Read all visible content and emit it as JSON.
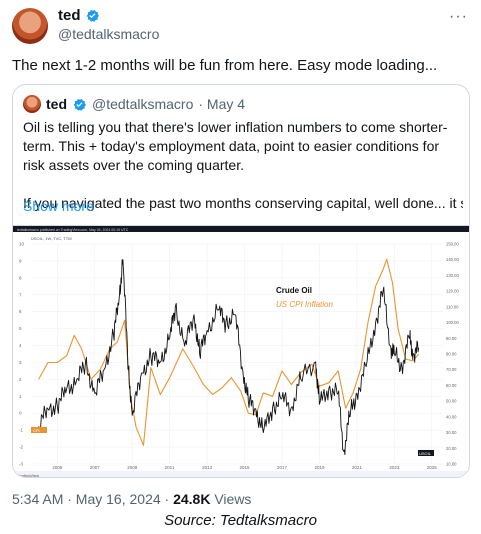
{
  "tweet": {
    "author_name": "ted",
    "author_handle": "@tedtalksmacro",
    "text": "The next 1-2 months will be fun from here. Easy mode loading...",
    "timestamp": "5:34 AM · May 16, 2024 ·",
    "views_count": "24.8K",
    "views_label": "Views",
    "more_label": "···"
  },
  "quote": {
    "author_name": "ted",
    "author_handle": "@tedtalksmacro",
    "date": "· May 4",
    "paragraph1": "Oil is telling you that there's lower inflation numbers to come shorter-term. This + today's employment data, point to easier conditions for risk assets over the coming quarter.",
    "paragraph2": "If you navigated the past two months conserving capital, well done... it shoul...",
    "show_more": "Show more"
  },
  "chart_data": {
    "type": "line",
    "legend": [
      "Crude Oil",
      "US CPI Inflation"
    ],
    "colors": {
      "crude": "#111111",
      "cpi": "#e8952f",
      "legend_cpi": "#e8952f"
    },
    "x_ticks": [
      "2005",
      "2007",
      "2009",
      "2011",
      "2013",
      "2015",
      "2017",
      "2019",
      "2021",
      "2023",
      "2025"
    ],
    "left_axis": {
      "ticks": [
        "10",
        "9",
        "8",
        "7",
        "6",
        "5",
        "4",
        "3",
        "2",
        "1",
        "0",
        "-1",
        "-2",
        "-3"
      ],
      "ylim": [
        -3,
        10
      ]
    },
    "right_axis": {
      "ticks": [
        "150.00",
        "140.00",
        "130.00",
        "120.00",
        "110.00",
        "100.00",
        "90.00",
        "80.00",
        "70.00",
        "60.00",
        "50.00",
        "40.00",
        "30.00",
        "20.00",
        "10.00"
      ],
      "ylim": [
        10,
        150
      ]
    },
    "series": [
      {
        "name": "US CPI Inflation",
        "axis": "left",
        "x": [
          2004,
          2004.5,
          2005,
          2005.5,
          2005.9,
          2006.3,
          2006.8,
          2007.3,
          2007.8,
          2008.2,
          2008.6,
          2008.9,
          2009.2,
          2009.6,
          2010,
          2010.5,
          2011,
          2011.7,
          2012.3,
          2012.8,
          2013.3,
          2013.8,
          2014.3,
          2014.8,
          2015.2,
          2015.6,
          2016,
          2016.5,
          2017,
          2017.5,
          2018,
          2018.6,
          2019,
          2019.5,
          2020,
          2020.4,
          2020.8,
          2021.2,
          2021.6,
          2022,
          2022.4,
          2022.6,
          2022.9,
          2023.2,
          2023.6,
          2024,
          2024.3
        ],
        "y": [
          2.0,
          3.0,
          3.0,
          3.4,
          4.6,
          3.8,
          2.0,
          2.6,
          3.8,
          4.2,
          5.5,
          1.0,
          -0.8,
          -1.9,
          2.7,
          1.1,
          2.1,
          3.8,
          2.7,
          1.7,
          1.1,
          1.5,
          2.1,
          1.3,
          0.0,
          -0.1,
          1.2,
          1.0,
          2.5,
          1.7,
          2.4,
          2.9,
          1.6,
          1.8,
          2.5,
          0.3,
          1.2,
          2.6,
          5.4,
          7.5,
          8.5,
          9.1,
          7.7,
          5.0,
          3.2,
          3.1,
          3.5
        ]
      },
      {
        "name": "Crude Oil",
        "axis": "right",
        "x": [
          2004,
          2004.5,
          2005,
          2005.5,
          2006,
          2006.5,
          2007,
          2007.5,
          2008,
          2008.3,
          2008.5,
          2008.8,
          2009,
          2009.5,
          2010,
          2010.5,
          2011,
          2011.3,
          2011.8,
          2012.3,
          2012.6,
          2013,
          2013.6,
          2014,
          2014.5,
          2014.9,
          2015.2,
          2015.6,
          2016,
          2016.5,
          2017,
          2017.5,
          2018,
          2018.8,
          2019,
          2019.5,
          2020,
          2020.3,
          2020.6,
          2021,
          2021.5,
          2022,
          2022.4,
          2022.8,
          2023,
          2023.4,
          2023.8,
          2024,
          2024.3
        ],
        "y": [
          34,
          45,
          47,
          58,
          62,
          74,
          55,
          70,
          92,
          115,
          140,
          70,
          41,
          68,
          78,
          75,
          90,
          110,
          85,
          105,
          80,
          95,
          108,
          100,
          105,
          70,
          50,
          45,
          30,
          46,
          52,
          46,
          64,
          75,
          48,
          58,
          55,
          18,
          40,
          55,
          72,
          100,
          120,
          85,
          80,
          72,
          90,
          80,
          84
        ]
      }
    ],
    "right_label": "USOIL",
    "left_label": "CPI",
    "small_header": "tedtalksmacro published on TradingView.com, May 04, 2024 00:19 UTC",
    "small_series_label": "USOIL, 1W, TVC, TTM",
    "watermark": "TradingView"
  },
  "source_caption": "Source: Tedtalksmacro"
}
